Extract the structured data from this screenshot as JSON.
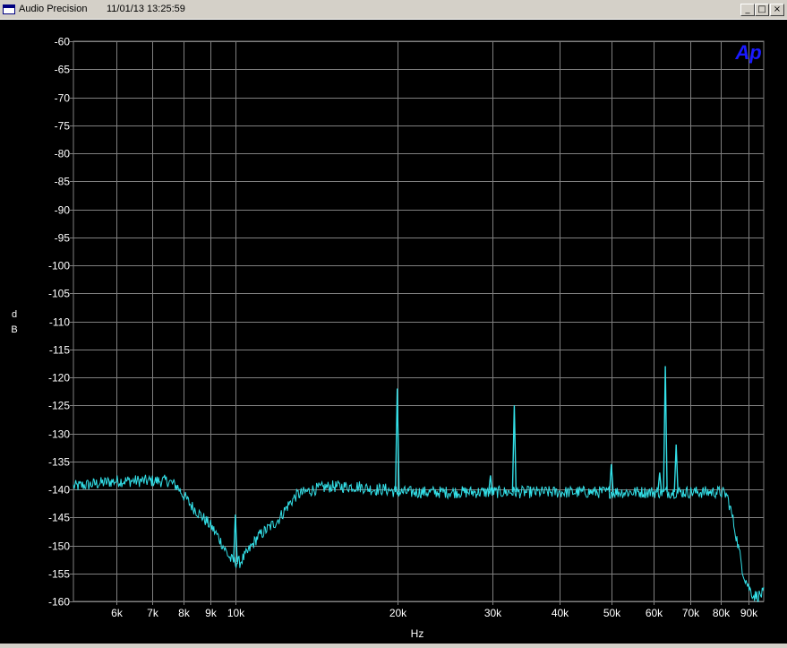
{
  "window": {
    "title": "Audio Precision",
    "timestamp": "11/01/13 13:25:59",
    "minimize_glyph": "_",
    "maximize_glyph": "□",
    "close_glyph": "×"
  },
  "logo": {
    "text": "Ap",
    "color": "#1a1aff"
  },
  "colors": {
    "background": "#000000",
    "grid": "#808080",
    "trace": "#33e0e8",
    "text": "#ffffff"
  },
  "chart_data": {
    "type": "line",
    "xlabel": "Hz",
    "ylabel": "dB",
    "xscale": "log",
    "xlim": [
      5000,
      96000
    ],
    "ylim": [
      -160,
      -60
    ],
    "grid": true,
    "x_ticks": [
      6000,
      7000,
      8000,
      9000,
      10000,
      20000,
      30000,
      40000,
      50000,
      60000,
      70000,
      80000,
      90000
    ],
    "x_tick_labels": [
      "6k",
      "7k",
      "8k",
      "9k",
      "10k",
      "20k",
      "30k",
      "40k",
      "50k",
      "60k",
      "70k",
      "80k",
      "90k"
    ],
    "y_ticks": [
      -60,
      -65,
      -70,
      -75,
      -80,
      -85,
      -90,
      -95,
      -100,
      -105,
      -110,
      -115,
      -120,
      -125,
      -130,
      -135,
      -140,
      -145,
      -150,
      -155,
      -160
    ],
    "y_tick_labels": [
      "-60",
      "-65",
      "-70",
      "-75",
      "-80",
      "-85",
      "-90",
      "-95",
      "-100",
      "-105",
      "-110",
      "-115",
      "-120",
      "-125",
      "-130",
      "-135",
      "-140",
      "-145",
      "-150",
      "-155",
      "-160"
    ],
    "series": [
      {
        "x": [
          5000,
          5500,
          6000,
          6500,
          7000,
          7500,
          7800,
          8000,
          8300,
          8600,
          9000,
          9300,
          9600,
          9800,
          10000,
          10200,
          10500,
          11000,
          11500,
          12000,
          12500,
          13000,
          14000,
          15000,
          16000,
          17000,
          18000,
          19000,
          20000,
          22000,
          25000,
          28000,
          30000,
          32000,
          35000,
          40000,
          45000,
          50000,
          55000,
          58000,
          60000,
          63000,
          66000,
          70000,
          75000,
          80000,
          82000,
          84000,
          86000,
          88000,
          90000,
          92000,
          94000,
          96000
        ],
        "y": [
          -139.5,
          -139,
          -138.5,
          -138.5,
          -138.5,
          -138.5,
          -139.5,
          -141,
          -143,
          -144.5,
          -146.5,
          -148.5,
          -151,
          -152.5,
          -153,
          -153,
          -151.5,
          -148.5,
          -147,
          -145.5,
          -143,
          -141,
          -140,
          -139.5,
          -139.5,
          -139.5,
          -140,
          -140,
          -140.5,
          -140.5,
          -140.5,
          -140.5,
          -140.5,
          -140.5,
          -140.5,
          -140.5,
          -140.5,
          -140.5,
          -140.5,
          -140.5,
          -140.5,
          -140.5,
          -140.5,
          -140.5,
          -140.5,
          -140.5,
          -141,
          -145,
          -150,
          -155,
          -157.5,
          -159,
          -159,
          -158.5
        ]
      }
    ],
    "spikes": [
      {
        "x": 10000,
        "y": -144.5
      },
      {
        "x": 20000,
        "y": -122
      },
      {
        "x": 29800,
        "y": -137.5
      },
      {
        "x": 33000,
        "y": -125
      },
      {
        "x": 50000,
        "y": -135.5
      },
      {
        "x": 61500,
        "y": -137
      },
      {
        "x": 63000,
        "y": -118
      },
      {
        "x": 66000,
        "y": -132
      }
    ]
  }
}
